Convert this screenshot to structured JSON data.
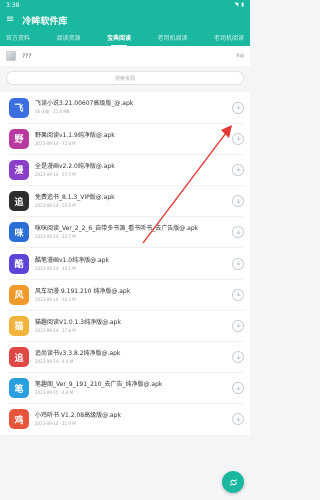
{
  "status_bar": {
    "time": "3:38",
    "battery": "▮"
  },
  "app_bar": {
    "title": "冷眸软件库"
  },
  "tabs": [
    {
      "label": "官方资料",
      "active": false
    },
    {
      "label": "阅读资源",
      "active": false
    },
    {
      "label": "宝典阅读",
      "active": true
    },
    {
      "label": "老司机阅读",
      "active": false
    },
    {
      "label": "老司机阅读",
      "active": false
    }
  ],
  "user": {
    "name": "???",
    "right_text": "率级"
  },
  "search": {
    "placeholder": "搜索资源"
  },
  "colors": {
    "primary": "#1bb8a0",
    "arrow": "#e53935"
  },
  "files": [
    {
      "name": "飞读小说3.21.00607高级版_@.apk",
      "meta": "16 天前 · 21.0 MB",
      "icon_label": "飞",
      "icon_bg": "#3b6fe0"
    },
    {
      "name": "野果阅读v1.1.9纯净版@.apk",
      "meta": "2023-09-14 · 72.8 M",
      "icon_label": "野",
      "icon_bg": "#b83a9e"
    },
    {
      "name": "全是漫画v2.2.0纯净版@.apk",
      "meta": "2023-09-14 · 57.5 M",
      "icon_label": "漫",
      "icon_bg": "#8a3fc8"
    },
    {
      "name": "免费追书_8.1.3_VIP版@.apk",
      "meta": "2023-09-14 · 55.9 M",
      "icon_label": "追",
      "icon_bg": "#2e2e2e"
    },
    {
      "name": "咪咪阅读_Ver_2_2_6_自带多书源_看书听书_去广告版@.apk",
      "meta": "2023-09-14 · 23.7 M",
      "icon_label": "咪",
      "icon_bg": "#2a6fd6"
    },
    {
      "name": "酷笔漫画v1.0纯净版@.apk",
      "meta": "2023-09-14 · 40.1 M",
      "icon_label": "酷",
      "icon_bg": "#5b44d8"
    },
    {
      "name": "风车动漫 9.191.210 纯净版@.apk",
      "meta": "2023-09-14 · 30.3 M",
      "icon_label": "风",
      "icon_bg": "#f09a2a"
    },
    {
      "name": "猫趣阅读V1.0.1.3纯净版@.apk",
      "meta": "2023-09-14 · 17.8 M",
      "icon_label": "猫",
      "icon_bg": "#f2b33d"
    },
    {
      "name": "追尚读书v3.3.8.2纯净版@.apk",
      "meta": "2023-09-14 · 4.4 M",
      "icon_label": "追",
      "icon_bg": "#e04848"
    },
    {
      "name": "笔趣阁_Ver_9_191_210_去广告_纯净版@.apk",
      "meta": "2023-09-15 · 4.4 M",
      "icon_label": "笔",
      "icon_bg": "#2a9fe0"
    },
    {
      "name": "小鸡听书 V1.2.08高级版@.apk",
      "meta": "2023-09-14 · 21.9 M",
      "icon_label": "鸡",
      "icon_bg": "#e8553a"
    }
  ]
}
